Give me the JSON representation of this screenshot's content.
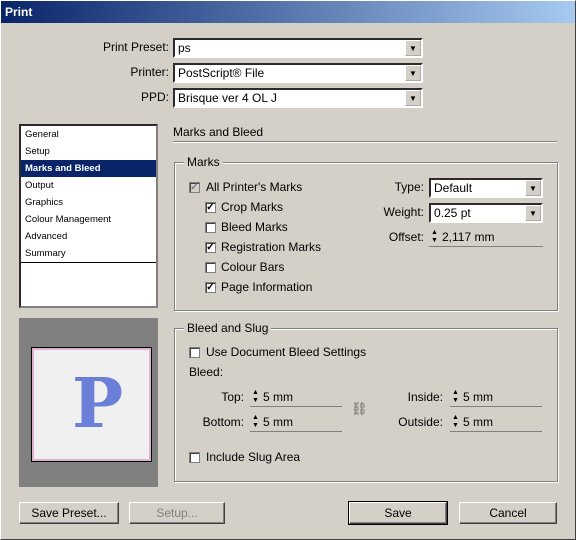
{
  "window": {
    "title": "Print"
  },
  "header": {
    "print_preset_label": "Print Preset:",
    "print_preset_value": "ps",
    "printer_label": "Printer:",
    "printer_value": "PostScript® File",
    "ppd_label": "PPD:",
    "ppd_value": "Brisque ver 4 OL J"
  },
  "sidebar": {
    "items": [
      {
        "label": "General"
      },
      {
        "label": "Setup"
      },
      {
        "label": "Marks and Bleed"
      },
      {
        "label": "Output"
      },
      {
        "label": "Graphics"
      },
      {
        "label": "Colour Management"
      },
      {
        "label": "Advanced"
      },
      {
        "label": "Summary"
      }
    ],
    "selected_index": 2
  },
  "preview": {
    "letter": "P"
  },
  "section": {
    "title": "Marks and Bleed"
  },
  "marks": {
    "group_title": "Marks",
    "all_printers_marks": {
      "label": "All Printer's Marks",
      "checked": true,
      "enabled": false
    },
    "crop_marks": {
      "label": "Crop Marks",
      "checked": true
    },
    "bleed_marks": {
      "label": "Bleed Marks",
      "checked": false
    },
    "registration_marks": {
      "label": "Registration Marks",
      "checked": true
    },
    "colour_bars": {
      "label": "Colour Bars",
      "checked": false
    },
    "page_information": {
      "label": "Page Information",
      "checked": true
    },
    "type_label": "Type:",
    "type_value": "Default",
    "weight_label": "Weight:",
    "weight_value": "0.25 pt",
    "offset_label": "Offset:",
    "offset_value": "2,117 mm"
  },
  "bleed_slug": {
    "group_title": "Bleed and Slug",
    "use_document_bleed": {
      "label": "Use Document Bleed Settings",
      "checked": false
    },
    "bleed_label": "Bleed:",
    "top_label": "Top:",
    "top_value": "5 mm",
    "bottom_label": "Bottom:",
    "bottom_value": "5 mm",
    "inside_label": "Inside:",
    "inside_value": "5 mm",
    "outside_label": "Outside:",
    "outside_value": "5 mm",
    "include_slug": {
      "label": "Include Slug Area",
      "checked": false
    }
  },
  "buttons": {
    "save_preset": "Save Preset...",
    "setup": "Setup...",
    "save": "Save",
    "cancel": "Cancel"
  }
}
